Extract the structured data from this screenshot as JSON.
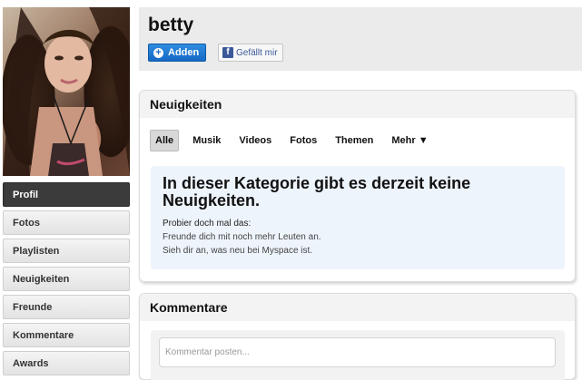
{
  "profile": {
    "name": "betty",
    "add_label": "Adden",
    "like_label": "Gefällt mir",
    "like_icon": "f"
  },
  "sidebar": {
    "items": [
      {
        "label": "Profil",
        "active": true
      },
      {
        "label": "Fotos",
        "active": false
      },
      {
        "label": "Playlisten",
        "active": false
      },
      {
        "label": "Neuigkeiten",
        "active": false
      },
      {
        "label": "Freunde",
        "active": false
      },
      {
        "label": "Kommentare",
        "active": false
      },
      {
        "label": "Awards",
        "active": false
      }
    ]
  },
  "news": {
    "title": "Neuigkeiten",
    "filters": [
      "Alle",
      "Musik",
      "Videos",
      "Fotos",
      "Themen",
      "Mehr ▼"
    ],
    "active_filter": "Alle",
    "empty_title": "In dieser Kategorie gibt es derzeit keine Neuigkeiten.",
    "hint": "Probier doch mal das:",
    "suggestions": [
      "Freunde dich mit noch mehr Leuten an.",
      "Sieh dir an, was neu bei Myspace ist."
    ]
  },
  "comments": {
    "title": "Kommentare",
    "placeholder": "Kommentar posten..."
  },
  "colors": {
    "accent_blue": "#1668c4",
    "active_nav": "#3b3b3b",
    "empty_bg": "#eef4fc",
    "facebook_blue": "#3b5998"
  }
}
